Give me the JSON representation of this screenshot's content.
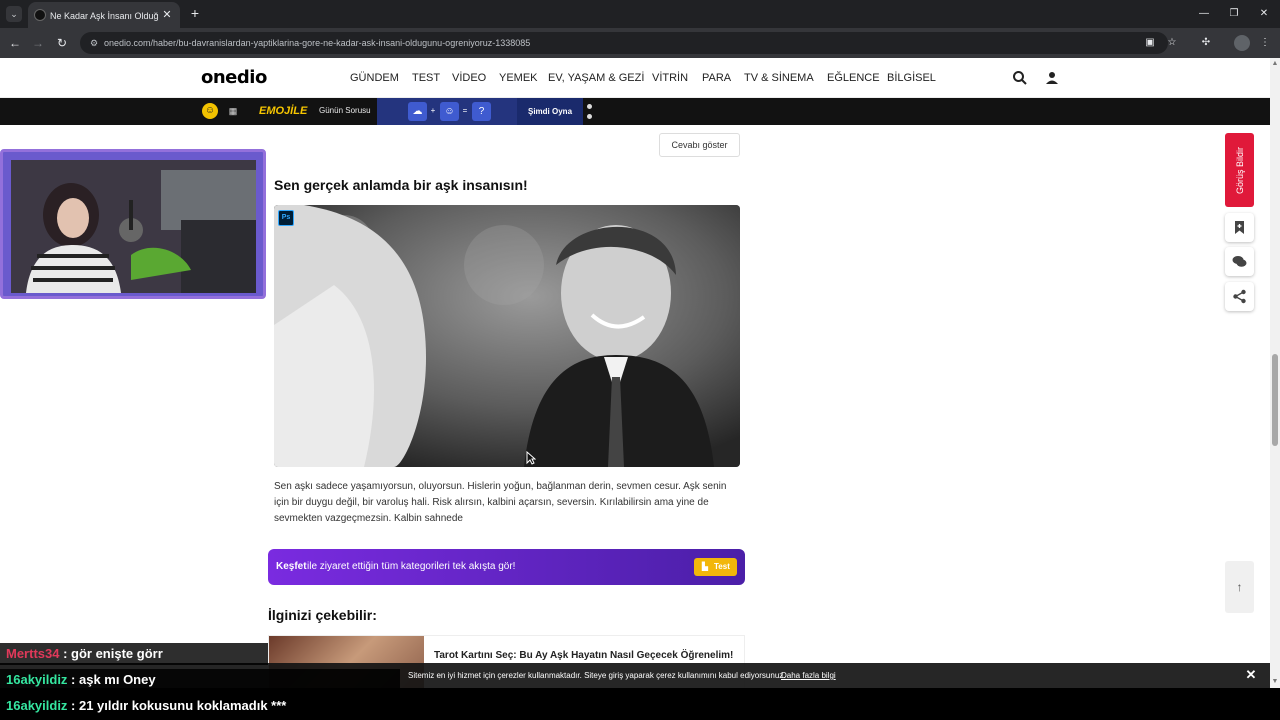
{
  "browser": {
    "tab_title": "Ne Kadar Aşk İnsanı Olduğunu",
    "url": "onedio.com/haber/bu-davranislardan-yaptiklarina-gore-ne-kadar-ask-insani-oldugunu-ogreniyoruz-1338085"
  },
  "site": {
    "logo": "onedio",
    "nav": [
      "GÜNDEM",
      "TEST",
      "VİDEO",
      "YEMEK",
      "EV, YAŞAM & GEZİ",
      "VİTRİN",
      "PARA",
      "TV & SİNEMA",
      "EĞLENCE",
      "BİLGİSEL"
    ]
  },
  "promo": {
    "brand": "EMOJİLE",
    "question": "Günün Sorusu",
    "emoji_op1": "+",
    "emoji_op2": "=",
    "emoji_unknown": "?",
    "play_label": "Şimdi Oyna"
  },
  "article": {
    "show_answer": "Cevabı göster",
    "result_title": "Sen gerçek anlamda bir aşk insanısın!",
    "ps_badge": "Ps",
    "description": "Sen aşkı sadece yaşamıyorsun, oluyorsun. Hislerin yoğun, bağlanman derin, sevmen cesur. Aşk senin için bir duygu değil, bir varoluş hali. Risk alırsın, kalbini açarsın, seversin. Kırılabilirsin ama yine de sevmekten vazgeçmezsin. Kalbin sahnede"
  },
  "kesfet": {
    "strong": "Keşfet",
    "text": "ile ziyaret ettiğin tüm kategorileri tek akışta gör!",
    "badge": "Test"
  },
  "related": {
    "title": "İlginizi çekebilir:",
    "card_title": "Tarot Kartını Seç: Bu Ay Aşk Hayatın Nasıl Geçecek Öğrenelim!"
  },
  "side": {
    "feedback": "Görüş Bildir"
  },
  "cookie": {
    "text": "Sitemiz en iyi hizmet için çerezler kullanmaktadır. Siteye giriş yaparak çerez kullanımını kabul ediyorsunuz.",
    "link": "Daha fazla bilgi"
  },
  "chat": [
    {
      "user": "Mertts34",
      "message": " : gör enişte görr",
      "color": "#e0395a"
    },
    {
      "user": "16akyildiz",
      "message": " : aşk mı Oney",
      "color": "#35e6a0"
    },
    {
      "user": "16akyildiz",
      "message": " : 21 yıldır kokusunu koklamadık ***",
      "color": "#35e6a0"
    }
  ]
}
